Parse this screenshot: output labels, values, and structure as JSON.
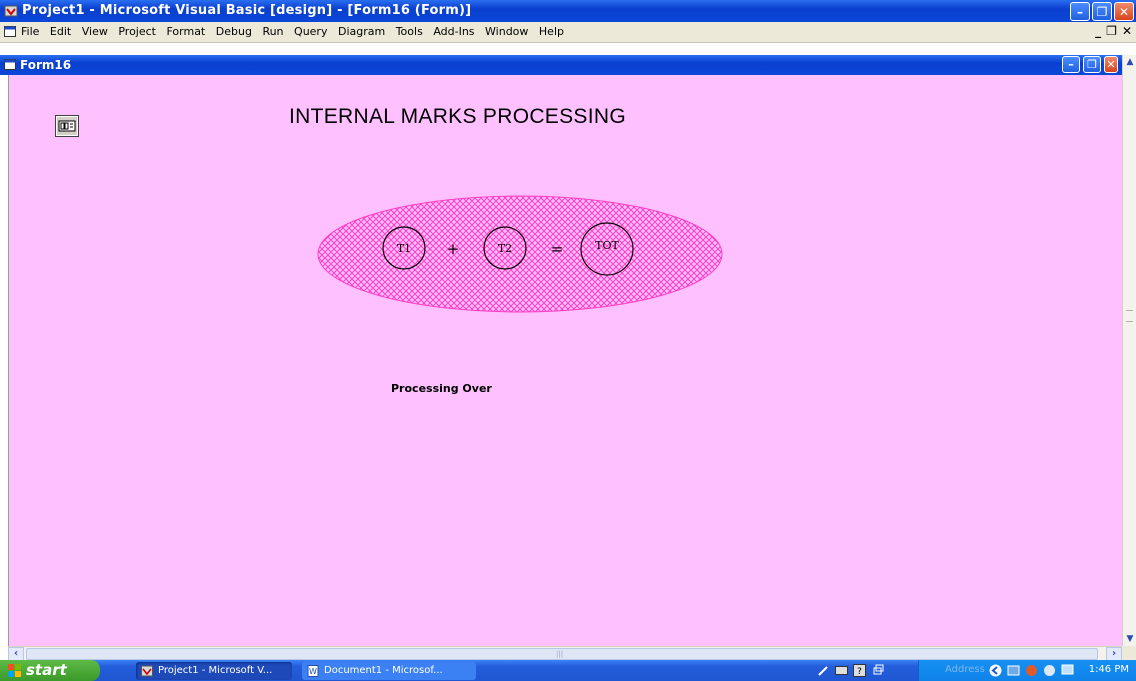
{
  "app": {
    "title": "Project1 - Microsoft Visual Basic [design] - [Form16 (Form)]"
  },
  "menu": {
    "items": [
      "File",
      "Edit",
      "View",
      "Project",
      "Format",
      "Debug",
      "Run",
      "Query",
      "Diagram",
      "Tools",
      "Add-Ins",
      "Window",
      "Help"
    ]
  },
  "form": {
    "title": "Form16",
    "heading": "INTERNAL MARKS PROCESSING",
    "status": "Processing Over",
    "background": "#ffc0ff",
    "diagram": {
      "t1": "T1",
      "plus": "+",
      "t2": "T2",
      "equals": "=",
      "tot": "TOT",
      "fill_color": "#ff40c8"
    }
  },
  "taskbar": {
    "start": "start",
    "buttons": [
      {
        "label": "Project1 - Microsoft V..."
      },
      {
        "label": "Document1 - Microsof..."
      }
    ],
    "address": "Address",
    "clock": "1:46 PM"
  },
  "colors": {
    "titlebar": "#0b47d8",
    "menubar": "#ece9d8",
    "taskbar": "#245edb",
    "start": "#3a9a2a"
  }
}
